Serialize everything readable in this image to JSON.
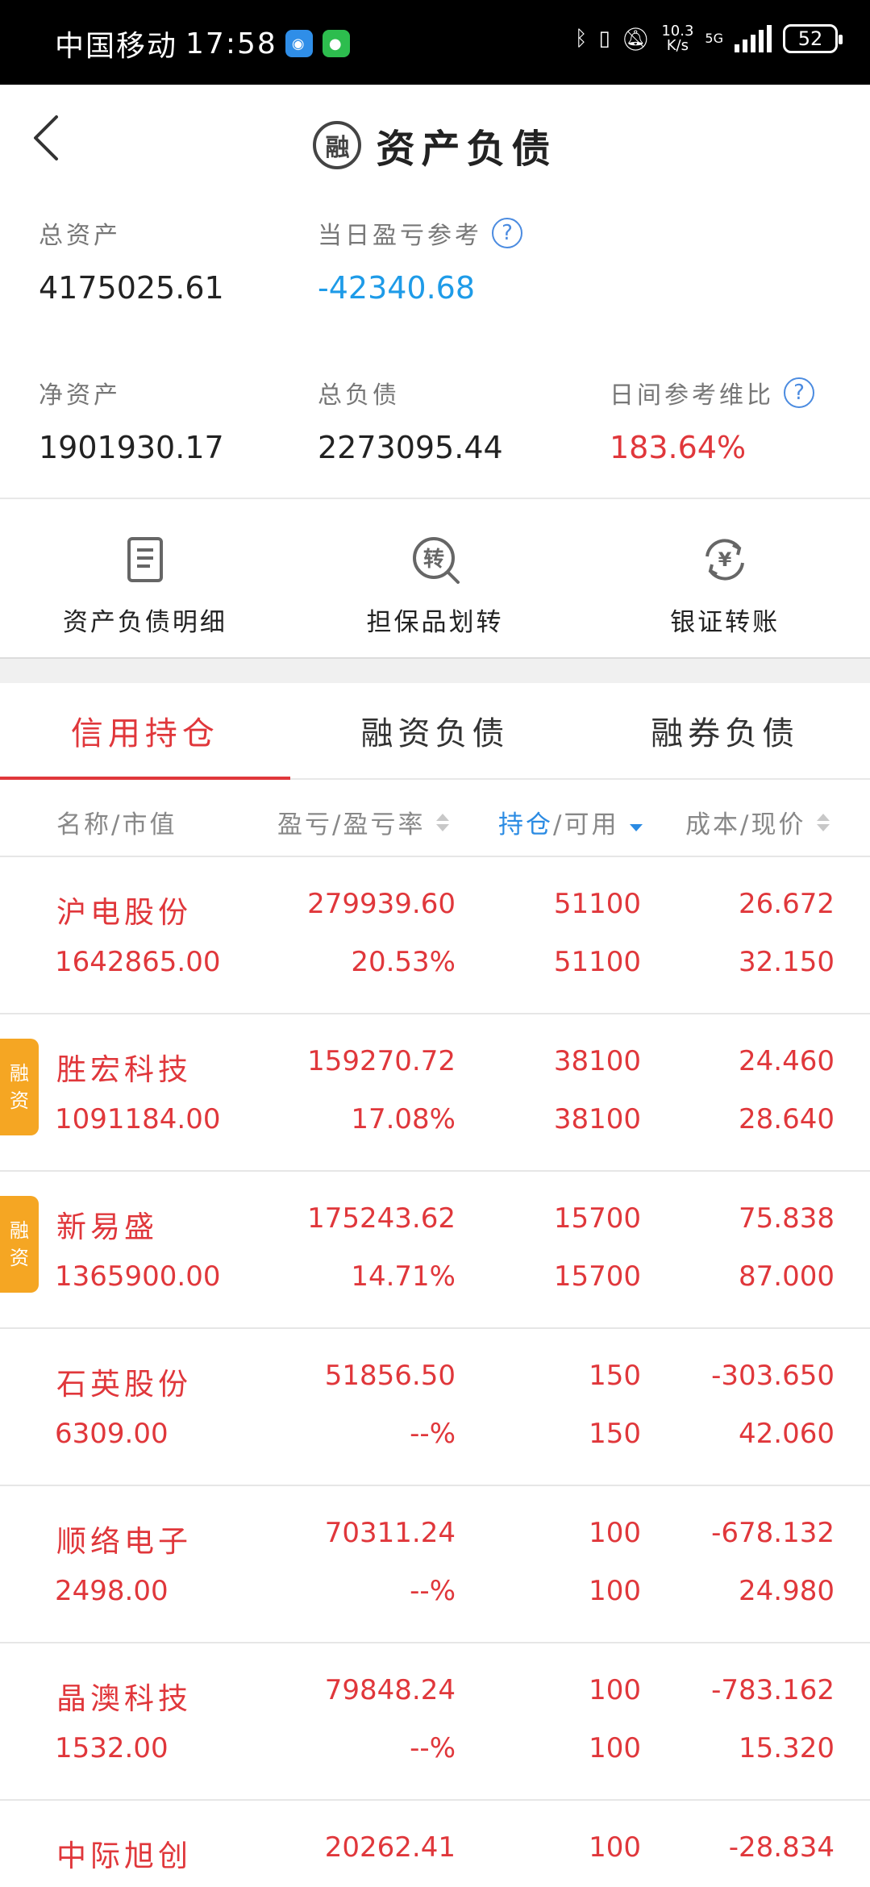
{
  "status_bar": {
    "carrier": "中国移动",
    "time": "17:58",
    "net_speed_value": "10.3",
    "net_speed_unit": "K/s",
    "network": "5G",
    "battery": "52"
  },
  "header": {
    "logo_text": "融",
    "title": "资产负债"
  },
  "summary": {
    "total_assets_label": "总资产",
    "total_assets_value": "4175025.61",
    "daily_pl_label": "当日盈亏参考",
    "daily_pl_value": "-42340.68",
    "net_assets_label": "净资产",
    "net_assets_value": "1901930.17",
    "total_liab_label": "总负债",
    "total_liab_value": "2273095.44",
    "maint_ratio_label": "日间参考维比",
    "maint_ratio_value": "183.64%",
    "help_glyph": "?"
  },
  "actions": [
    {
      "label": "资产负债明细",
      "icon": "document-icon"
    },
    {
      "label": "担保品划转",
      "icon": "transfer-icon",
      "icon_text": "转"
    },
    {
      "label": "银证转账",
      "icon": "yen-exchange-icon",
      "icon_text": "¥"
    }
  ],
  "tabs": [
    {
      "label": "信用持仓",
      "active": true
    },
    {
      "label": "融资负债",
      "active": false
    },
    {
      "label": "融券负债",
      "active": false
    }
  ],
  "columns": {
    "name": "名称/市值",
    "pl": "盈亏/盈亏率",
    "hold_a": "持仓",
    "hold_b": "/可用",
    "cost": "成本/现价"
  },
  "holdings": [
    {
      "name": "沪电股份",
      "market_value": "1642865.00",
      "pl": "279939.60",
      "pl_rate": "20.53%",
      "hold": "51100",
      "avail": "51100",
      "cost": "26.672",
      "price": "32.150",
      "tag": ""
    },
    {
      "name": "胜宏科技",
      "market_value": "1091184.00",
      "pl": "159270.72",
      "pl_rate": "17.08%",
      "hold": "38100",
      "avail": "38100",
      "cost": "24.460",
      "price": "28.640",
      "tag": "融资"
    },
    {
      "name": "新易盛",
      "market_value": "1365900.00",
      "pl": "175243.62",
      "pl_rate": "14.71%",
      "hold": "15700",
      "avail": "15700",
      "cost": "75.838",
      "price": "87.000",
      "tag": "融资"
    },
    {
      "name": "石英股份",
      "market_value": "6309.00",
      "pl": "51856.50",
      "pl_rate": "--%",
      "hold": "150",
      "avail": "150",
      "cost": "-303.650",
      "price": "42.060",
      "tag": ""
    },
    {
      "name": "顺络电子",
      "market_value": "2498.00",
      "pl": "70311.24",
      "pl_rate": "--%",
      "hold": "100",
      "avail": "100",
      "cost": "-678.132",
      "price": "24.980",
      "tag": ""
    },
    {
      "name": "晶澳科技",
      "market_value": "1532.00",
      "pl": "79848.24",
      "pl_rate": "--%",
      "hold": "100",
      "avail": "100",
      "cost": "-783.162",
      "price": "15.320",
      "tag": ""
    },
    {
      "name": "中际旭创",
      "market_value": "",
      "pl": "20262.41",
      "pl_rate": "",
      "hold": "100",
      "avail": "",
      "cost": "-28.834",
      "price": "",
      "tag": ""
    }
  ],
  "colors": {
    "accent_red": "#e0373b",
    "accent_blue": "#1e9be8",
    "tag_orange": "#f5a623"
  }
}
